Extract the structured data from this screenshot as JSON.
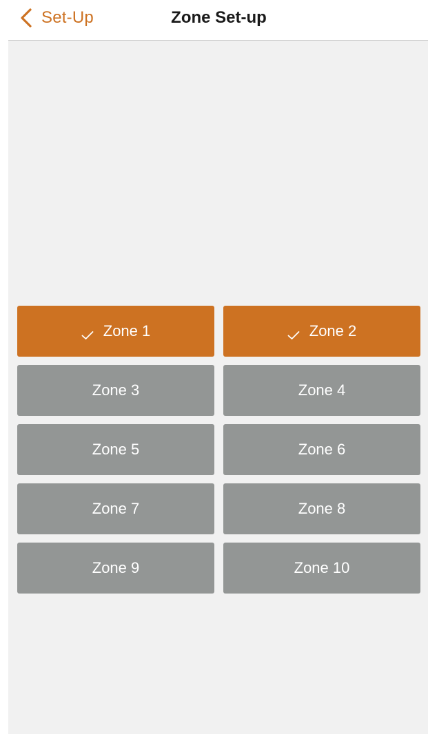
{
  "nav": {
    "back_label": "Set-Up",
    "title": "Zone Set-up"
  },
  "colors": {
    "accent": "#cd7222",
    "zone_unselected": "#939695",
    "background": "#f1f1f1"
  },
  "zones": [
    {
      "label": "Zone 1",
      "selected": true
    },
    {
      "label": "Zone 2",
      "selected": true
    },
    {
      "label": "Zone 3",
      "selected": false
    },
    {
      "label": "Zone 4",
      "selected": false
    },
    {
      "label": "Zone 5",
      "selected": false
    },
    {
      "label": "Zone 6",
      "selected": false
    },
    {
      "label": "Zone 7",
      "selected": false
    },
    {
      "label": "Zone 8",
      "selected": false
    },
    {
      "label": "Zone 9",
      "selected": false
    },
    {
      "label": "Zone 10",
      "selected": false
    }
  ]
}
